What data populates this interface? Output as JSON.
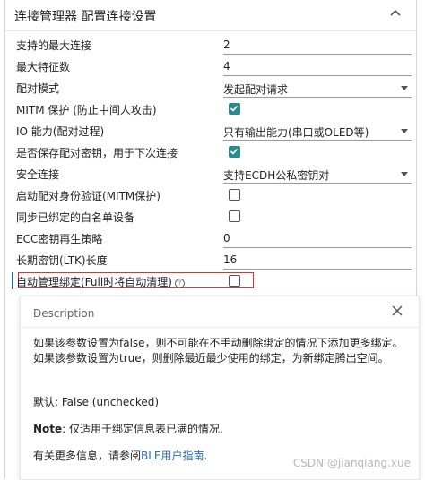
{
  "header": {
    "title": "连接管理器  配置连接设置",
    "collapse_icon": "chevron-up-icon"
  },
  "rows": [
    {
      "label": "支持的最大连接",
      "type": "text",
      "value": "2"
    },
    {
      "label": "最大特征数",
      "type": "text",
      "value": "4"
    },
    {
      "label": "配对模式",
      "type": "select",
      "value": "发起配对请求"
    },
    {
      "label": "MITM 保护 (防止中间人攻击)",
      "type": "checkbox",
      "checked": true
    },
    {
      "label": "IO 能力(配对过程)",
      "type": "select",
      "value": "只有输出能力(串口或OLED等)"
    },
    {
      "label": "是否保存配对密钥，用于下次连接",
      "type": "checkbox",
      "checked": true
    },
    {
      "label": "安全连接",
      "type": "select",
      "value": "支持ECDH公私密钥对"
    },
    {
      "label": "启动配对身份验证(MITM保护)",
      "type": "checkbox",
      "checked": false
    },
    {
      "label": "同步已绑定的白名单设备",
      "type": "checkbox",
      "checked": false
    },
    {
      "label": "ECC密钥再生策略",
      "type": "text",
      "value": "0"
    },
    {
      "label": "长期密钥(LTK)长度",
      "type": "text",
      "value": "16"
    },
    {
      "label": "自动管理绑定(Full时将自动清理)",
      "type": "checkbox",
      "checked": false
    }
  ],
  "description": {
    "title": "Description",
    "para1": "如果该参数设置为false，则不可能在不手动删除绑定的情况下添加更多绑定。如果该参数设置为true，则删除最近最少使用的绑定，为新绑定腾出空间。",
    "default_text": "默认: False (unchecked)",
    "note_label": "Note",
    "note_text": ": 仅适用于绑定信息表已满的情况.",
    "more_prefix": "有关更多信息，请参阅",
    "more_link": "BLE用户指南",
    "more_suffix": "."
  },
  "watermark": "CSDN @jianqiang.xue",
  "colors": {
    "accent": "#2b8a8a",
    "highlight": "#d23a3a",
    "link": "#2c6fb7"
  }
}
